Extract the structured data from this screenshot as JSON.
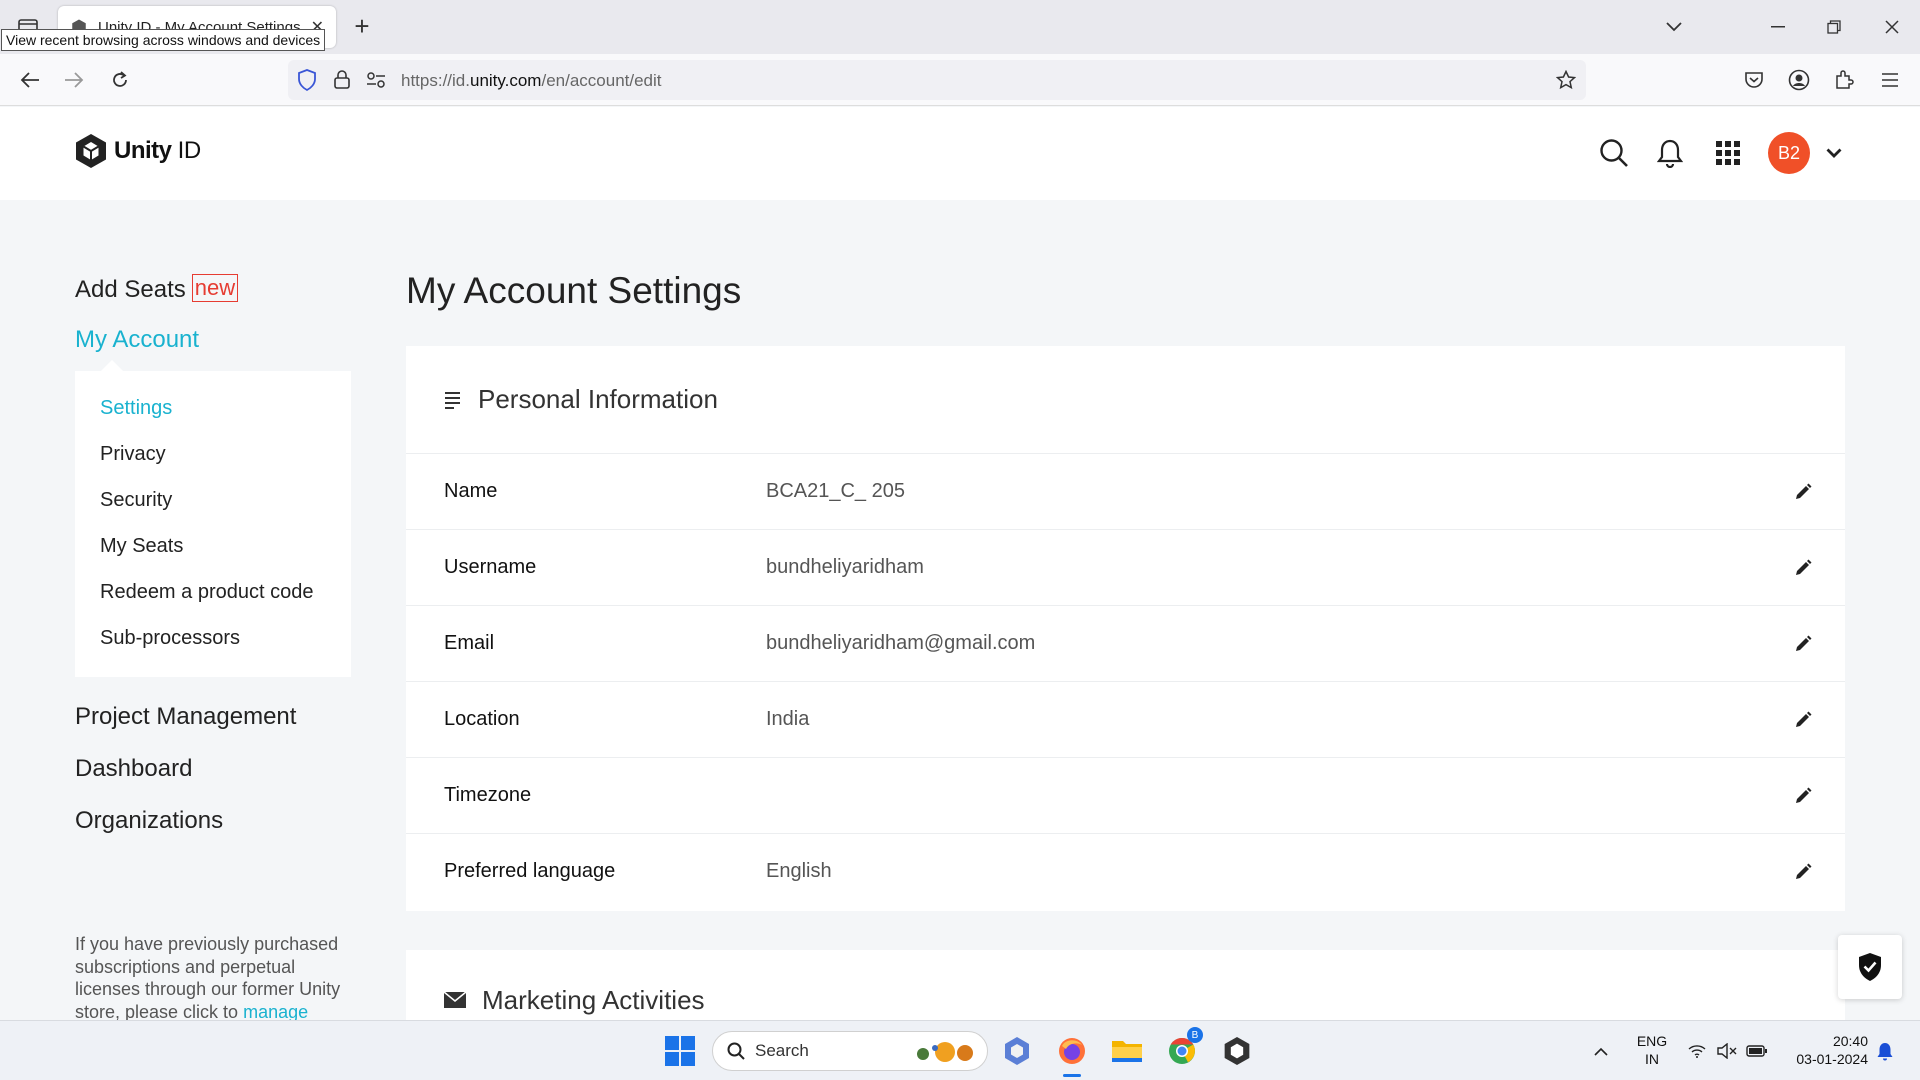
{
  "browser": {
    "tab_title": "Unity ID - My Account Settings",
    "tab_close": "✕",
    "new_tab": "+",
    "tooltip": "View recent browsing across windows and devices",
    "url_prefix": "https://id.",
    "url_domain": "unity.com",
    "url_path": "/en/account/edit"
  },
  "header": {
    "logo_bold": "Unity",
    "logo_light": " ID",
    "avatar_initials": "B2"
  },
  "sidebar": {
    "add_seats": "Add Seats",
    "new_badge": "new",
    "my_account": "My Account",
    "submenu": [
      "Settings",
      "Privacy",
      "Security",
      "My Seats",
      "Redeem a product code",
      "Sub-processors"
    ],
    "project_management": "Project Management",
    "dashboard": "Dashboard",
    "organizations": "Organizations",
    "note_text": "If you have previously purchased subscriptions and perpetual licenses through our former Unity store, please click to ",
    "note_link": "manage"
  },
  "main": {
    "page_title": "My Account Settings",
    "personal_info_title": "Personal Information",
    "rows": [
      {
        "label": "Name",
        "value": "BCA21_C_ 205"
      },
      {
        "label": "Username",
        "value": "bundheliyaridham"
      },
      {
        "label": "Email",
        "value": "bundheliyaridham@gmail.com"
      },
      {
        "label": "Location",
        "value": "India"
      },
      {
        "label": "Timezone",
        "value": ""
      },
      {
        "label": "Preferred language",
        "value": "English"
      }
    ],
    "marketing_title": "Marketing Activities"
  },
  "taskbar": {
    "search_label": "Search",
    "lang_1": "ENG",
    "lang_2": "IN",
    "time": "20:40",
    "date": "03-01-2024",
    "chrome_badge": "B"
  },
  "colors": {
    "accent": "#19b2cf",
    "avatar": "#f05028",
    "badge_red": "#e63c32"
  }
}
